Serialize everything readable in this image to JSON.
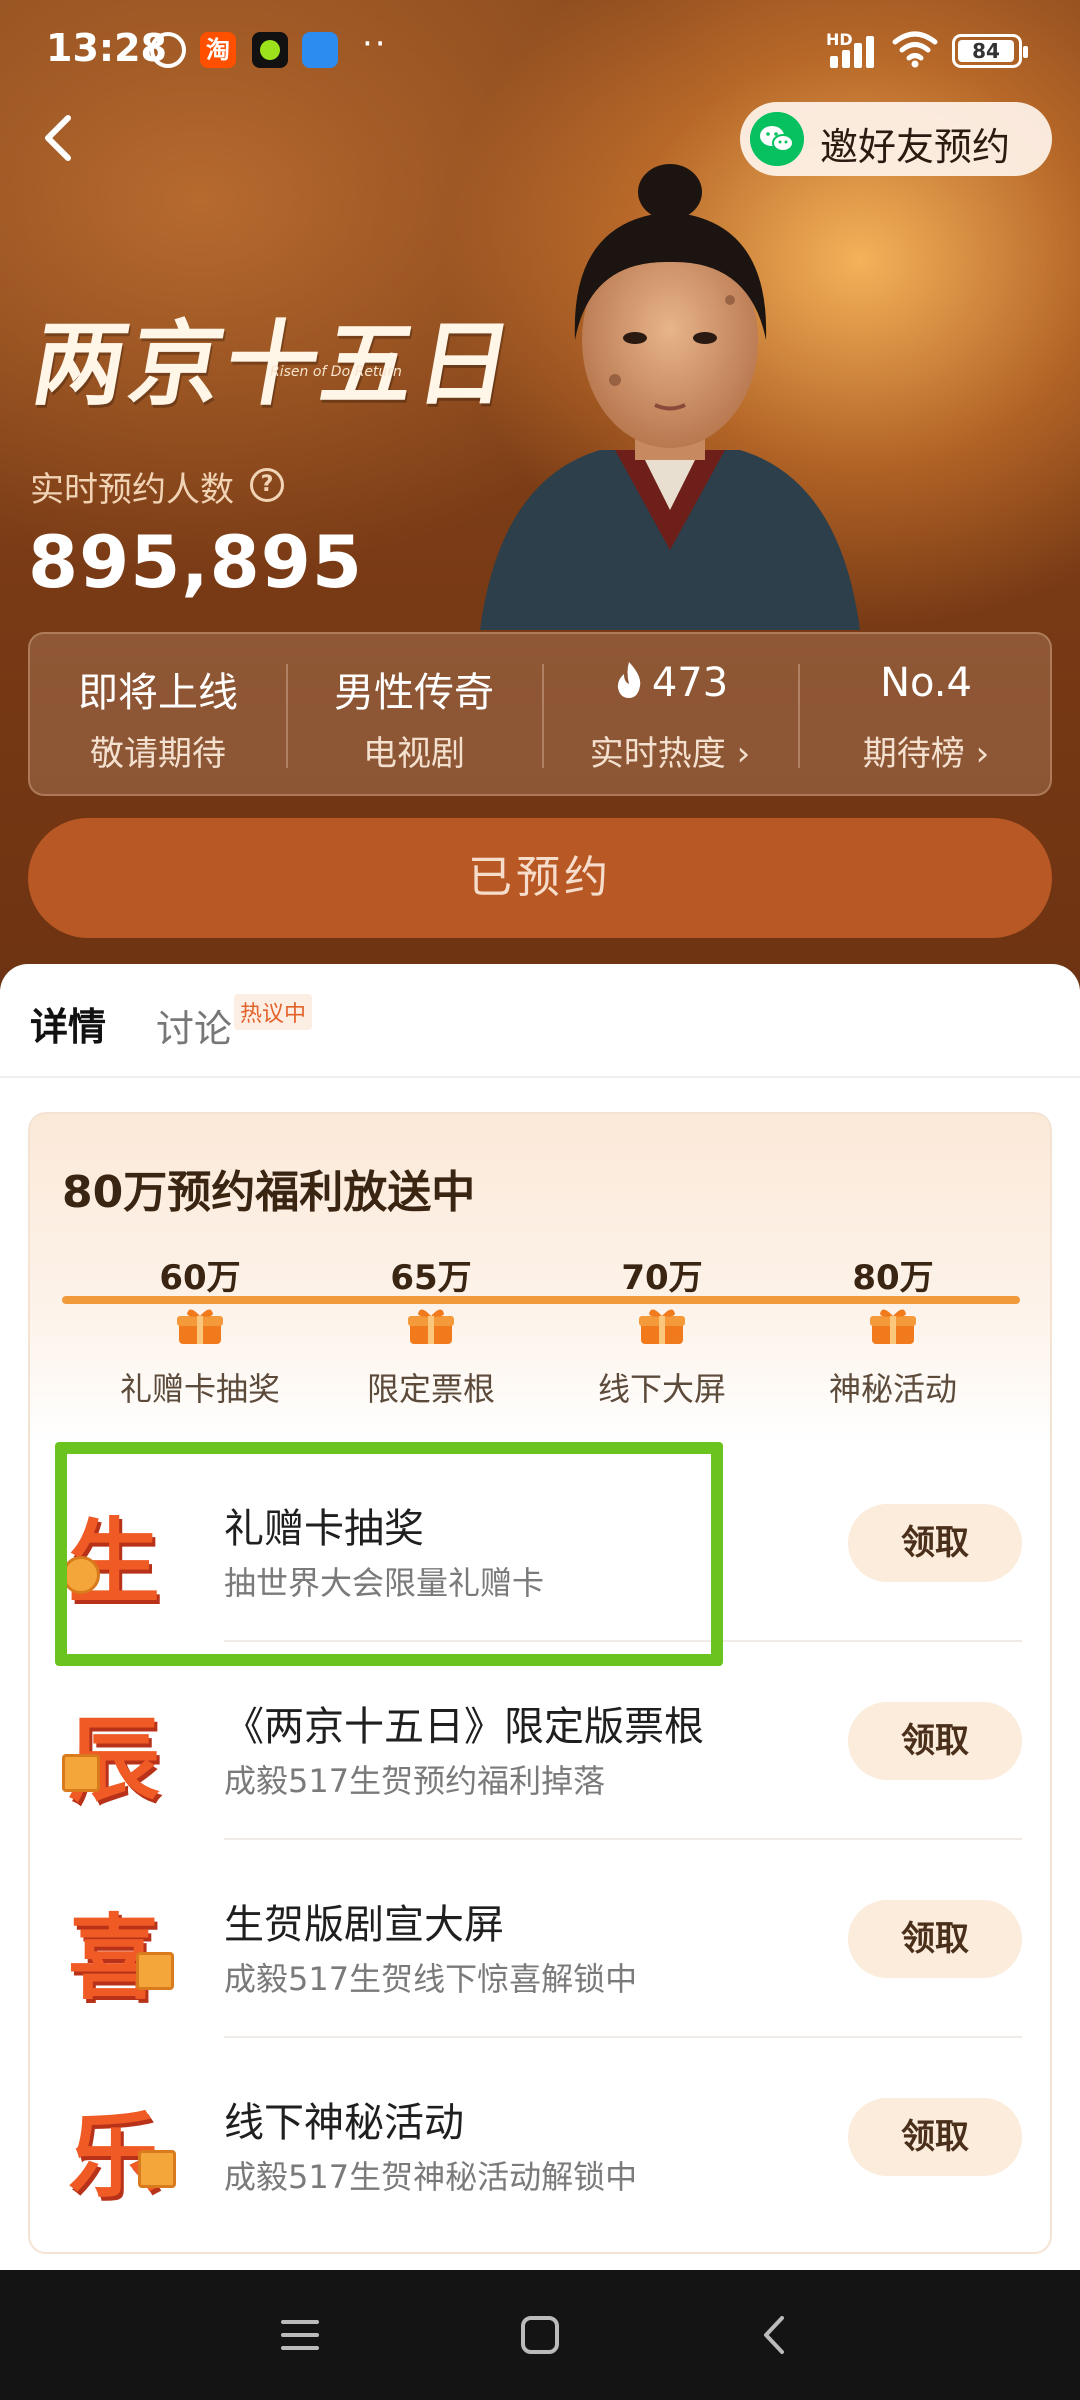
{
  "status_bar": {
    "time": "13:28",
    "taobao_label": "淘",
    "hd_label": "HD",
    "battery": "84"
  },
  "header": {
    "invite_label": "邀好友预约",
    "show_title": "两京十五日",
    "show_subtitle": "Risen of Do Return"
  },
  "reservation": {
    "label": "实时预约人数",
    "help_icon": "question-circle-icon",
    "count": "895,895"
  },
  "stats": [
    {
      "value": "即将上线",
      "caption": "敬请期待"
    },
    {
      "value": "男性传奇",
      "caption": "电视剧"
    },
    {
      "value": "473",
      "caption": "实时热度 ›",
      "icon": "flame-icon"
    },
    {
      "value": "No.4",
      "caption": "期待榜 ›"
    }
  ],
  "reserve_button": "已预约",
  "tabs": {
    "detail": "详情",
    "discuss": "讨论",
    "hot_badge": "热议中"
  },
  "welfare": {
    "title": "80万预约福利放送中",
    "milestones": [
      {
        "amount": "60万",
        "name": "礼赠卡抽奖"
      },
      {
        "amount": "65万",
        "name": "限定票根"
      },
      {
        "amount": "70万",
        "name": "线下大屏"
      },
      {
        "amount": "80万",
        "name": "神秘活动"
      }
    ],
    "rewards": [
      {
        "char": "生",
        "title": "礼赠卡抽奖",
        "subtitle": "抽世界大会限量礼赠卡",
        "button": "领取"
      },
      {
        "char": "辰",
        "title": "《两京十五日》限定版票根",
        "subtitle": "成毅517生贺预约福利掉落",
        "button": "领取"
      },
      {
        "char": "喜",
        "title": "生贺版剧宣大屏",
        "subtitle": "成毅517生贺线下惊喜解锁中",
        "button": "领取"
      },
      {
        "char": "乐",
        "title": "线下神秘活动",
        "subtitle": "成毅517生贺神秘活动解锁中",
        "button": "领取"
      }
    ]
  },
  "colors": {
    "accent": "#f09a3c",
    "reserve_button_bg": "#b85824",
    "highlight_border": "#6bc320",
    "badge_red": "#ef5a25"
  }
}
